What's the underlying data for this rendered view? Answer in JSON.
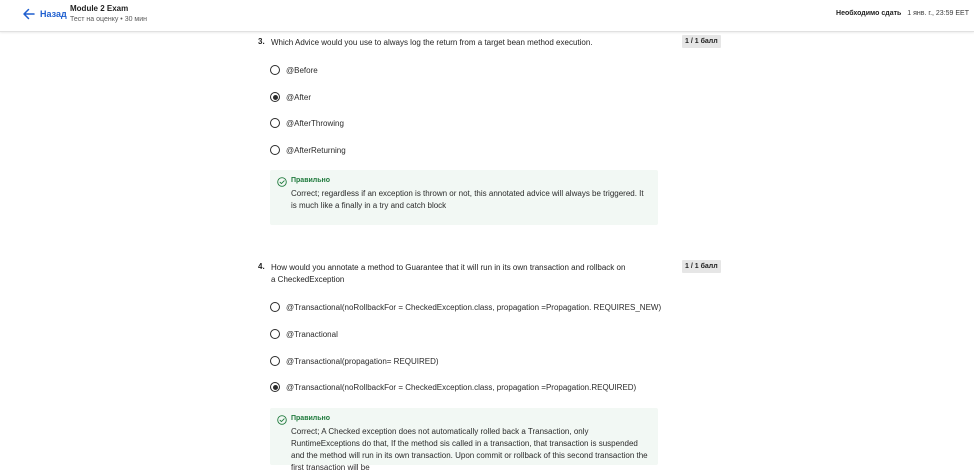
{
  "header": {
    "back_label": "Назад",
    "title": "Module 2 Exam",
    "subtitle": "Тест на оценку • 30 мин",
    "due_label": "Необходимо сдать",
    "due_date": "1 янв. г., 23:59 EET"
  },
  "questions": [
    {
      "number": "3.",
      "text": "Which Advice would you use to always log the return from a target bean method execution.",
      "score": "1 / 1 балл",
      "options": [
        "@Before",
        "@After",
        "@AfterThrowing",
        "@AfterReturning"
      ],
      "selected_index": 1,
      "feedback_title": "Правильно",
      "feedback_text": "Correct;  regardless if an exception is thrown or not, this annotated advice will always be triggered. It is much like a finally in a try and catch block"
    },
    {
      "number": "4.",
      "text": "How would you annotate a method to Guarantee that it will run in its own transaction and rollback on a CheckedException",
      "score": "1 / 1 балл",
      "options": [
        "@Transactional(noRollbackFor = CheckedException.class, propagation =Propagation. REQUIRES_NEW)",
        "@Tranactional",
        "@Transactional(propagation= REQUIRED)",
        "@Transactional(noRollbackFor = CheckedException.class, propagation =Propagation.REQUIRED)"
      ],
      "selected_index": 3,
      "feedback_title": "Правильно",
      "feedback_text": "Correct; A Checked exception does not automatically rolled back a Transaction, only RuntimeExceptions do that, If the method sis called in a transaction, that transaction is suspended and the method will run in its own transaction. Upon commit or rollback of this second transaction the first transaction will be"
    }
  ],
  "colors": {
    "accent": "#1f5fcf",
    "success": "#1f7a3c",
    "feedback_bg": "#f2f8f4",
    "score_bg": "#e6e6e6"
  },
  "icons": {
    "back": "arrow-left-icon",
    "correct": "check-circle-icon"
  }
}
